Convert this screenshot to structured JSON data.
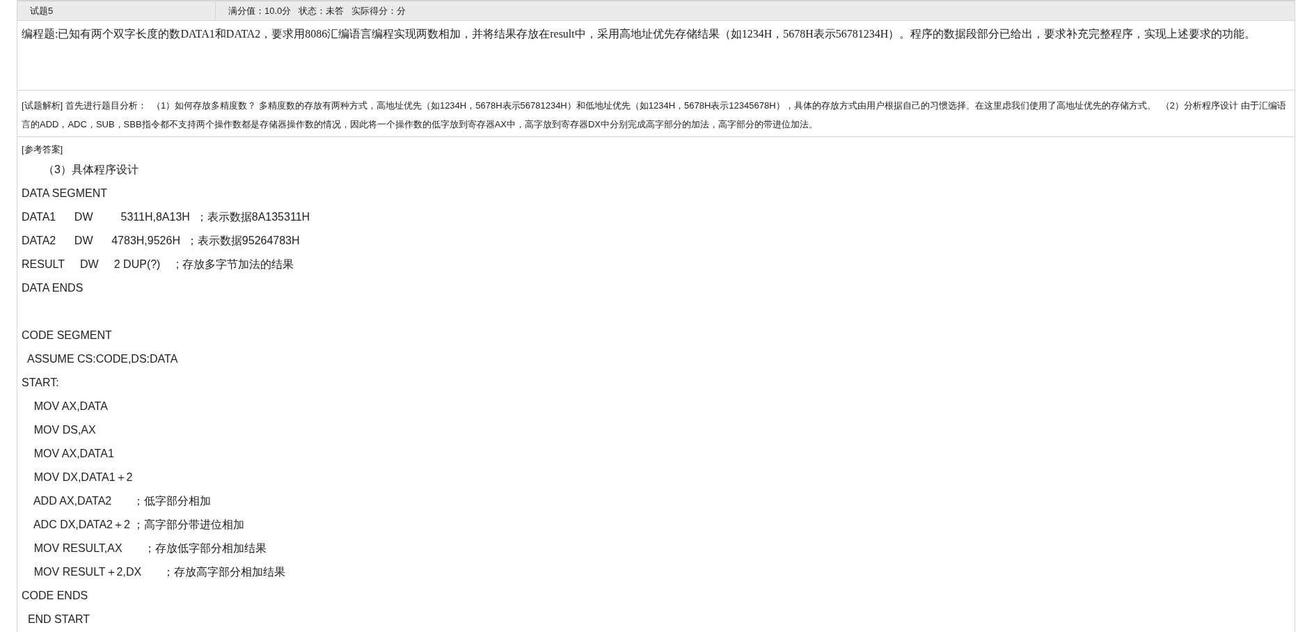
{
  "header": {
    "title": "试题5",
    "score_info": "满分值：10.0分   状态：未答   实际得分：分"
  },
  "question": "编程题:已知有两个双字长度的数DATA1和DATA2，要求用8086汇编语言编程实现两数相加，并将结果存放在result中，采用高地址优先存储结果（如1234H，5678H表示56781234H）。程序的数据段部分已给出，要求补充完整程序，实现上述要求的功能。",
  "analysis": "[试题解析] 首先进行题目分析：  （1）如何存放多精度数？ 多精度数的存放有两种方式，高地址优先（如1234H，5678H表示56781234H）和低地址优先（如1234H，5678H表示12345678H），具体的存放方式由用户根据自己的习惯选择。在这里虑我们使用了高地址优先的存储方式。  （2）分析程序设计 由于汇编语言的ADD，ADC，SUB，SBB指令都不支持两个操作数都是存储器操作数的情况，因此将一个操作数的低字放到寄存器AX中，高字放到寄存器DX中分别完成高字部分的加法，高字部分的带进位加法。",
  "answer_label": "[参考答案]",
  "code_blocks": [
    [
      "       （3）具体程序设计",
      "DATA SEGMENT",
      "DATA1      DW         5311H,8A13H  ；表示数据8A135311H",
      "DATA2      DW      4783H,9526H  ；表示数据95264783H",
      "RESULT     DW     2 DUP(?)     ; 存放多字节加法的结果",
      "DATA ENDS"
    ],
    [
      "CODE SEGMENT",
      "  ASSUME CS:CODE,DS:DATA",
      "START:",
      "    MOV AX,DATA",
      "    MOV DS,AX",
      "    MOV AX,DATA1",
      "    MOV DX,DATA1＋2",
      "    ADD AX,DATA2       ；低字部分相加",
      "    ADC DX,DATA2＋2 ；高字部分带进位相加",
      "    MOV RESULT,AX       ；存放低字部分相加结果",
      "    MOV RESULT＋2,DX       ；存放高字部分相加结果",
      "CODE ENDS",
      "  END START"
    ]
  ]
}
